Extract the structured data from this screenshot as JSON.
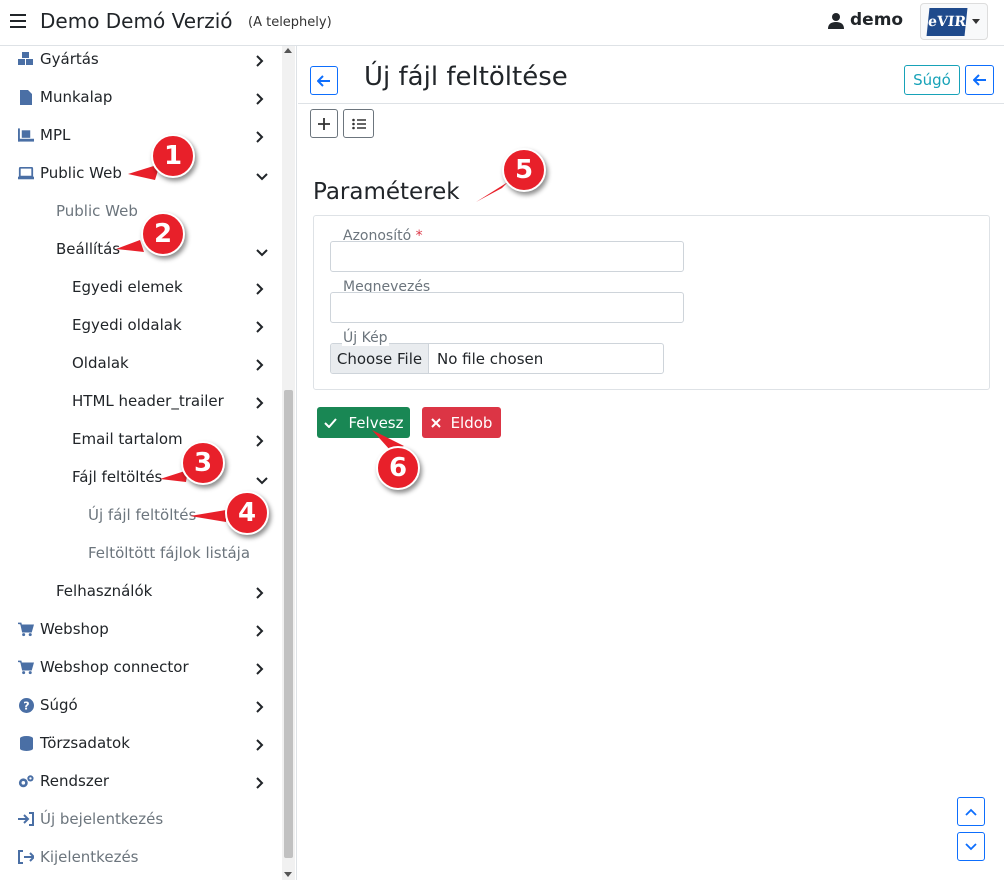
{
  "header": {
    "app_title": "Demo Demó Verzió",
    "site": "(A telephely)",
    "user": "demo",
    "logo_text": "eVIR"
  },
  "sidebar": {
    "items": [
      {
        "label": "Gyártás",
        "icon": "cubes-icon"
      },
      {
        "label": "Munkalap",
        "icon": "file-icon"
      },
      {
        "label": "MPL",
        "icon": "pallet-icon"
      },
      {
        "label": "Public Web",
        "icon": "laptop-code-icon"
      },
      {
        "label": "Public Web"
      },
      {
        "label": "Beállítás"
      },
      {
        "label": "Egyedi elemek"
      },
      {
        "label": "Egyedi oldalak"
      },
      {
        "label": "Oldalak"
      },
      {
        "label": "HTML header_trailer"
      },
      {
        "label": "Email tartalom"
      },
      {
        "label": "Fájl feltöltés"
      },
      {
        "label": "Új fájl feltöltés"
      },
      {
        "label": "Feltöltött fájlok listája"
      },
      {
        "label": "Felhasználók"
      },
      {
        "label": "Webshop",
        "icon": "cart-icon"
      },
      {
        "label": "Webshop connector",
        "icon": "cart-icon"
      },
      {
        "label": "Súgó",
        "icon": "question-circle-icon"
      },
      {
        "label": "Törzsadatok",
        "icon": "database-icon"
      },
      {
        "label": "Rendszer",
        "icon": "cogs-icon"
      },
      {
        "label": "Új bejelentkezés",
        "icon": "sign-in-icon"
      },
      {
        "label": "Kijelentkezés",
        "icon": "sign-out-icon"
      }
    ]
  },
  "main": {
    "title": "Új fájl feltöltése",
    "help_label": "Súgó",
    "section_title": "Paraméterek",
    "fields": {
      "azonosito_label": "Azonosító",
      "required_mark": "*",
      "azonosito_value": "",
      "megnevezes_label": "Megnevezés",
      "megnevezes_value": "",
      "kep_label": "Új Kép",
      "file_button": "Choose File",
      "file_status": "No file chosen"
    },
    "save_label": "Felvesz",
    "cancel_label": "Eldob"
  },
  "callouts": [
    "1",
    "2",
    "3",
    "4",
    "5",
    "6"
  ],
  "colors": {
    "primary": "#0d6efd",
    "success": "#198754",
    "danger": "#dc3545",
    "info": "#17a2b8",
    "callout": "#e8202a",
    "sidebar_icon": "#4a6fa5"
  }
}
